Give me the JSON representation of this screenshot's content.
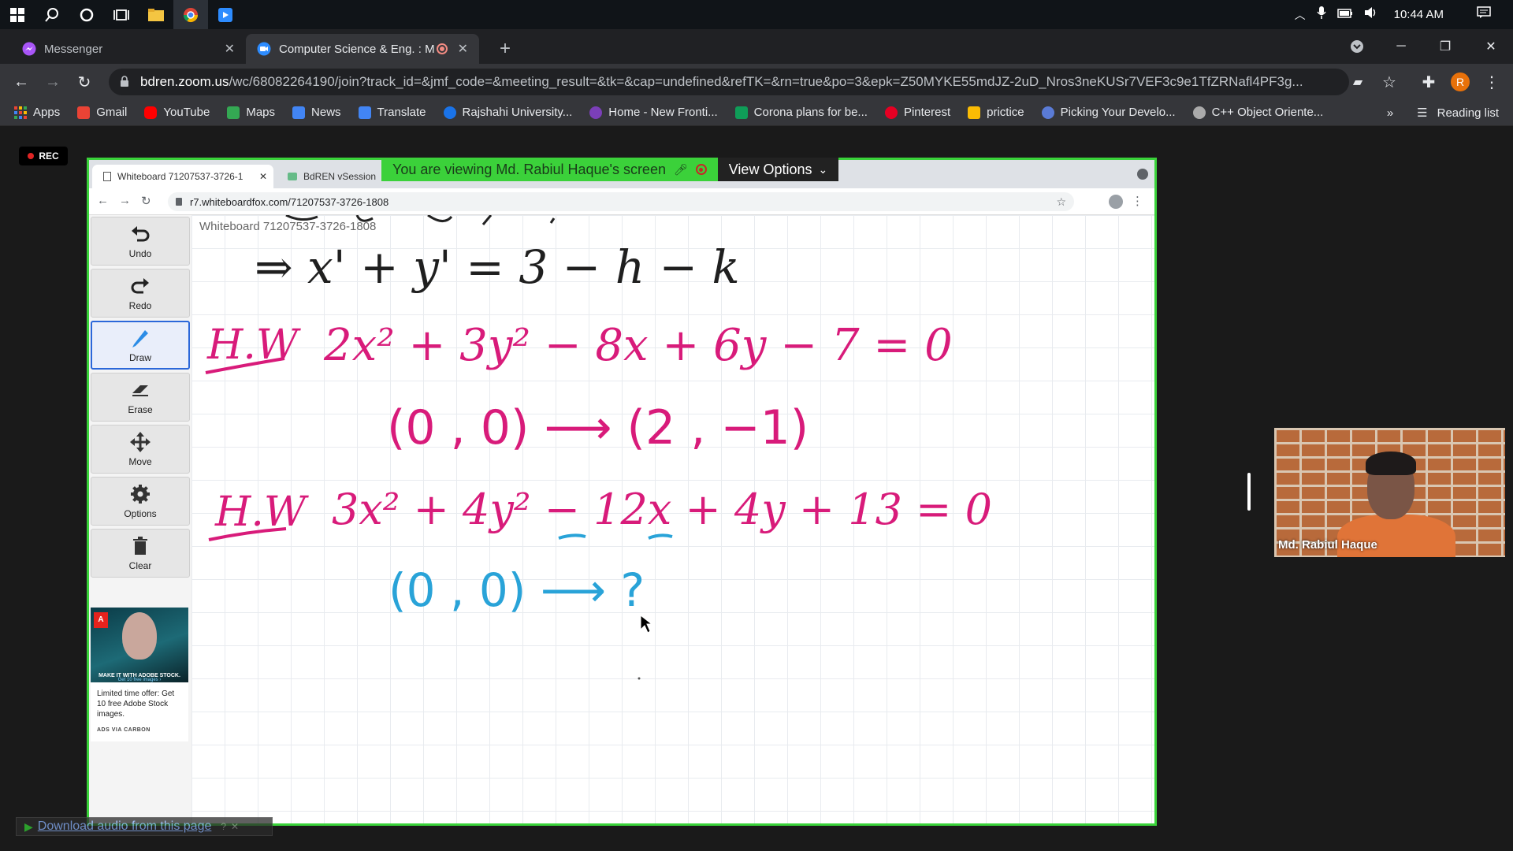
{
  "taskbar": {
    "time": "10:44 AM"
  },
  "browser": {
    "tabs": [
      {
        "label": "Messenger",
        "active": false
      },
      {
        "label": "Computer Science & Eng. : M",
        "active": true
      }
    ],
    "new_tab": "+",
    "address": {
      "host": "bdren.zoom.us",
      "path": "/wc/68082264190/join?track_id=&jmf_code=&meeting_result=&tk=&cap=undefined&refTK=&rn=true&po=3&epk=Z50MYKE55mdJZ-2uD_Nros3neKUSr7VEF3c9e1TfZRNafl4PF3g..."
    },
    "profile_initial": "R",
    "bookmarks": [
      {
        "label": "Apps",
        "color": "#4285f4"
      },
      {
        "label": "Gmail",
        "color": "#ea4335"
      },
      {
        "label": "YouTube",
        "color": "#ff0000"
      },
      {
        "label": "Maps",
        "color": "#34a853"
      },
      {
        "label": "News",
        "color": "#4285f4"
      },
      {
        "label": "Translate",
        "color": "#4285f4"
      },
      {
        "label": "Rajshahi University...",
        "color": "#1a73e8"
      },
      {
        "label": "Home - New Fronti...",
        "color": "#7b3fb8"
      },
      {
        "label": "Corona plans for be...",
        "color": "#0f9d58"
      },
      {
        "label": "Pinterest",
        "color": "#e60023"
      },
      {
        "label": "prictice",
        "color": "#fbbc04"
      },
      {
        "label": "Picking Your Develo...",
        "color": "#5a7bd6"
      },
      {
        "label": "C++ Object Oriente...",
        "color": "#aaaaaa"
      }
    ],
    "more": "»",
    "reading_list": "Reading list"
  },
  "zoom": {
    "rec": "REC",
    "banner": "You are viewing Md. Rabiul Haque's screen",
    "view_options": "View Options",
    "participant_name": "Md. Rabiul Haque"
  },
  "shared_screen": {
    "tabs": [
      {
        "label": "Whiteboard 71207537-3726-1",
        "active": true
      },
      {
        "label": "BdREN vSession",
        "active": false
      }
    ],
    "url": "r7.whiteboardfox.com/71207537-3726-1808",
    "whiteboard_title": "Whiteboard 71207537-3726-1808",
    "tools": [
      {
        "label": "Undo",
        "icon": "undo-icon"
      },
      {
        "label": "Redo",
        "icon": "redo-icon"
      },
      {
        "label": "Draw",
        "icon": "pencil-icon",
        "active": true
      },
      {
        "label": "Erase",
        "icon": "eraser-icon"
      },
      {
        "label": "Move",
        "icon": "move-icon"
      },
      {
        "label": "Options",
        "icon": "gear-icon"
      },
      {
        "label": "Clear",
        "icon": "trash-icon"
      }
    ],
    "ad": {
      "headline": "MAKE IT WITH ADOBE STOCK.",
      "sub": "Get 10 free images ›",
      "text": "Limited time offer: Get 10 free Adobe Stock images.",
      "via": "ADS VIA CARBON"
    },
    "handwriting": {
      "line1": "⇒ x' + y' = 3 − h − k",
      "hw1_label": "H.W",
      "hw1_eq": "2x² + 3y² − 8x + 6y − 7 = 0",
      "hw1_map": "(0 , 0) ⟶ (2 , −1)",
      "hw2_label": "H.W",
      "hw2_eq": "3x² + 4y² − 12x + 4y + 13 = 0",
      "hw2_map": "(0 , 0) ⟶ ?"
    }
  },
  "download_bar": "Download audio from this page"
}
